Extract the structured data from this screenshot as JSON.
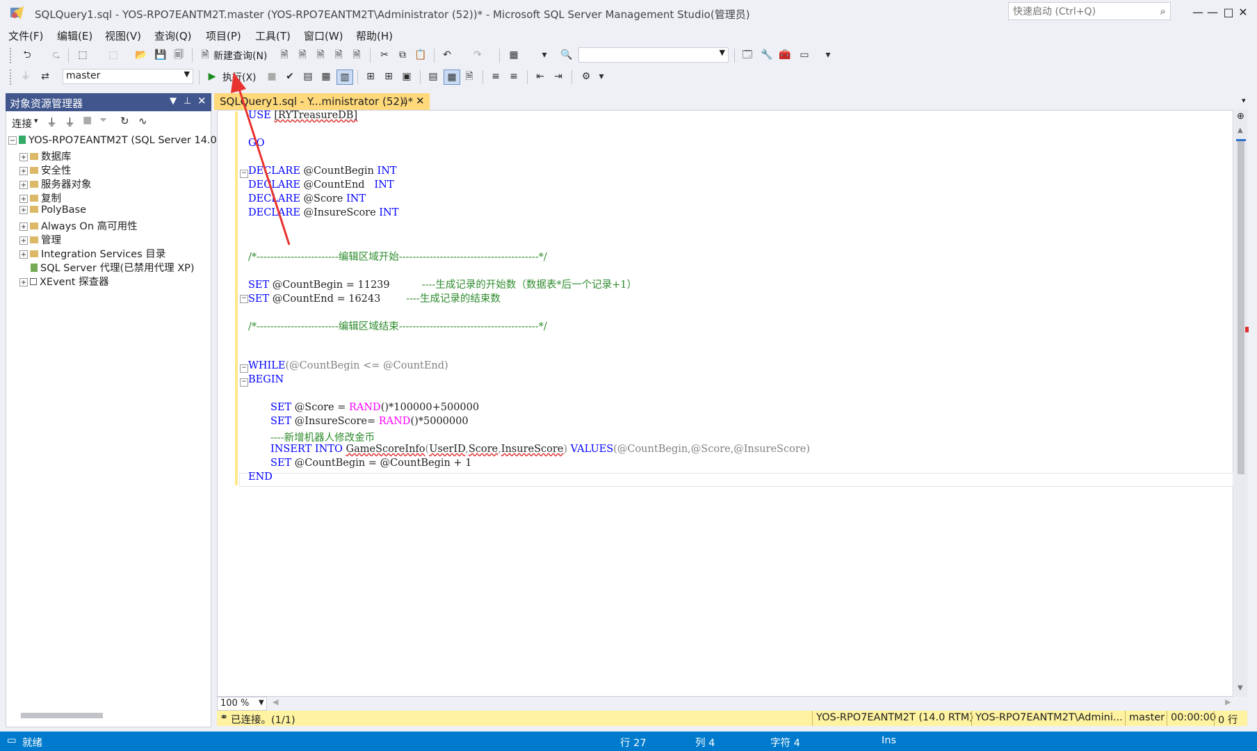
{
  "window": {
    "title": "SQLQuery1.sql - YOS-RPO7EANTM2T.master (YOS-RPO7EANTM2T\\Administrator (52))* - Microsoft SQL Server Management Studio(管理员)",
    "quick_launch_placeholder": "快速启动 (Ctrl+Q)",
    "minimize": "—",
    "maximize": "□",
    "close": "✕"
  },
  "menu": [
    "文件(F)",
    "编辑(E)",
    "视图(V)",
    "查询(Q)",
    "项目(P)",
    "工具(T)",
    "窗口(W)",
    "帮助(H)"
  ],
  "toolbar1": {
    "new_query": "新建查询(N)",
    "search_combo_value": ""
  },
  "toolbar2": {
    "database": "master",
    "execute": "执行(X)"
  },
  "object_explorer": {
    "title": "对象资源管理器",
    "connect": "连接",
    "server": "YOS-RPO7EANTM2T (SQL Server 14.0.",
    "nodes": [
      "数据库",
      "安全性",
      "服务器对象",
      "复制",
      "PolyBase",
      "Always On 高可用性",
      "管理",
      "Integration Services 目录",
      "SQL Server 代理(已禁用代理 XP)",
      "XEvent 探查器"
    ]
  },
  "editor": {
    "tab_label": "SQLQuery1.sql - Y...ministrator (52))*",
    "zoom": "100 %",
    "connection_status": "已连接。(1/1)",
    "conn_server": "YOS-RPO7EANTM2T (14.0 RTM)",
    "conn_user": "YOS-RPO7EANTM2T\\Admini...",
    "conn_db": "master",
    "conn_time": "00:00:00",
    "conn_rows": "0 行"
  },
  "code": {
    "l1_kw": "USE",
    "l1_obj": "[RYTreasureDB]",
    "l2": "GO",
    "declare": "DECLARE",
    "v_begin": "@CountBegin",
    "v_end": "@CountEnd",
    "v_score": "@Score",
    "v_insure": "@InsureScore",
    "int": "INT",
    "cm_start": "/*------------------------编辑区域开始-----------------------------------------*/",
    "set": "SET",
    "set1_rest": " @CountBegin = 11239",
    "set1_cm": "----生成记录的开始数（数据表*后一个记录+1）",
    "set2_rest": " @CountEnd = 16243",
    "set2_cm": "----生成记录的结束数",
    "cm_end": "/*------------------------编辑区域结束-----------------------------------------*/",
    "while": "WHILE",
    "while_rest": "(@CountBegin <= @CountEnd)",
    "begin": "BEGIN",
    "rand": "RAND",
    "s1_a": " @Score = ",
    "s1_b": "()*100000+500000",
    "s2_a": " @InsureScore= ",
    "s2_b": "()*5000000",
    "comment_robot": "----新增机器人修改金币",
    "insert": "INSERT",
    "into": "INTO",
    "table": "GameScoreInfo",
    "cols_open": "(",
    "col1": "UserID",
    "comma": ",",
    "col2": "Score",
    "col3": "InsureScore",
    "cols_close": ")",
    "values": "VALUES",
    "values_rest": "(@CountBegin,@Score,@InsureScore)",
    "s3_rest": " @CountBegin = @CountBegin + 1",
    "end": "END"
  },
  "status": {
    "ready": "就绪",
    "line": "行 27",
    "col": "列 4",
    "char": "字符 4",
    "ins": "Ins"
  },
  "colors": {
    "accent": "#007acc",
    "panel_header": "#40568d",
    "tab_active": "#ffd97a",
    "annotation_arrow": "#e8322e"
  }
}
